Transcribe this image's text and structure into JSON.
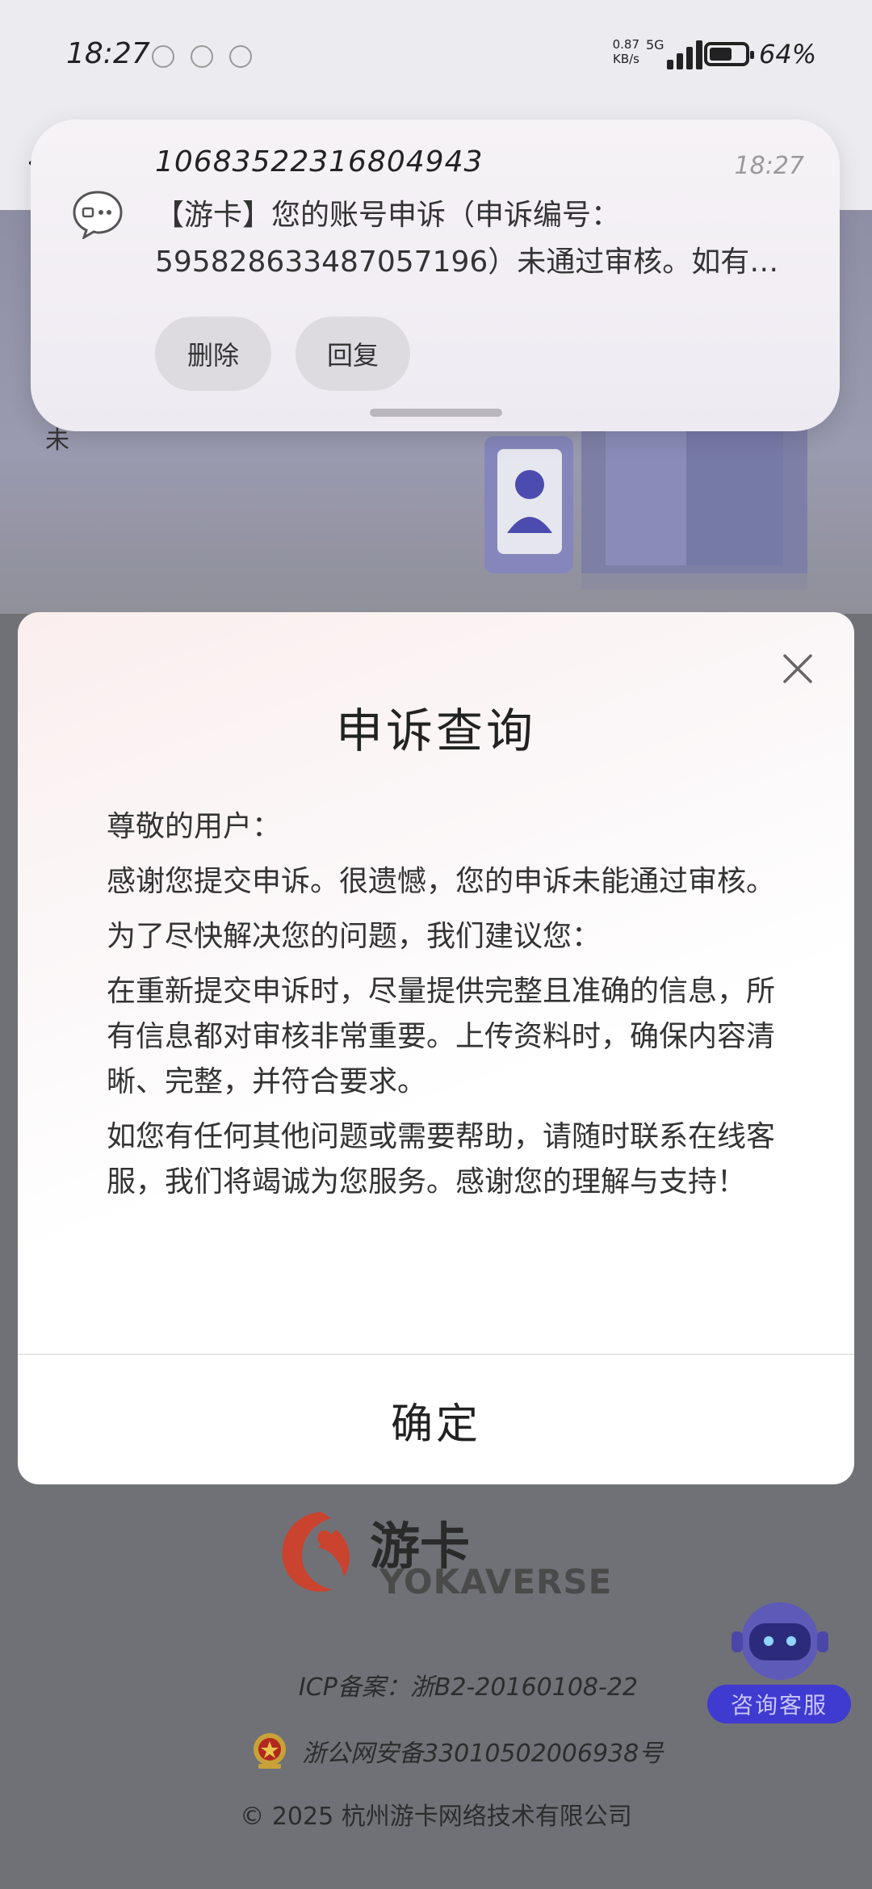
{
  "status_bar": {
    "time": "18:27",
    "net_speed": "0.87",
    "net_unit": "KB/s",
    "network_type": "5G",
    "battery_percent": "64%",
    "battery_level": 0.64
  },
  "notification": {
    "sender": "10683522316804943",
    "time": "18:27",
    "body": "【游卡】您的账号申诉（申诉编号：595828633487057196）未通过审核。如有…",
    "delete_label": "删除",
    "reply_label": "回复"
  },
  "background_page": {
    "fragment_text": "未"
  },
  "dialog": {
    "title": "申诉查询",
    "paragraphs": [
      "尊敬的用户：",
      "感谢您提交申诉。很遗憾，您的申诉未能通过审核。",
      "为了尽快解决您的问题，我们建议您：",
      "在重新提交申诉时，尽量提供完整且准确的信息，所有信息都对审核非常重要。上传资料时，确保内容清晰、完整，并符合要求。",
      "如您有任何其他问题或需要帮助，请随时联系在线客服，我们将竭诚为您服务。感谢您的理解与支持！"
    ],
    "confirm_label": "确定"
  },
  "footer": {
    "brand_cn": "游卡",
    "brand_en": "YOKAVERSE",
    "icp": "ICP备案：浙B2-20160108-22",
    "police_record": "浙公网安备33010502006938号",
    "copyright": "© 2025 杭州游卡网络技术有限公司"
  },
  "support_bot": {
    "label": "咨询客服"
  },
  "colors": {
    "accent_blue": "#3f3ad0",
    "logo_red": "#d2402e",
    "overlay_dim": "#6d6e75"
  }
}
